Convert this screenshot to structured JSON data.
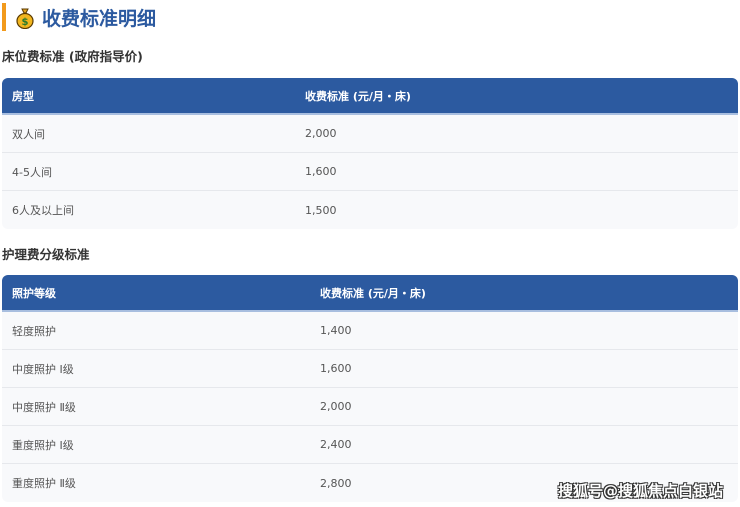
{
  "header": {
    "title": "收费标准明细",
    "icon": "money-bag-icon"
  },
  "bed_fees": {
    "title": "床位费标准 (政府指导价)",
    "columns": [
      "房型",
      "收费标准 (元/月・床)"
    ],
    "rows": [
      [
        "双人间",
        "2,000"
      ],
      [
        "4-5人间",
        "1,600"
      ],
      [
        "6人及以上间",
        "1,500"
      ]
    ]
  },
  "care_fees": {
    "title": "护理费分级标准",
    "columns": [
      "照护等级",
      "收费标准 (元/月・床)"
    ],
    "rows": [
      [
        "轻度照护",
        "1,400"
      ],
      [
        "中度照护 Ⅰ级",
        "1,600"
      ],
      [
        "中度照护 Ⅱ级",
        "2,000"
      ],
      [
        "重度照护 Ⅰ级",
        "2,400"
      ],
      [
        "重度照护 Ⅱ级",
        "2,800"
      ]
    ]
  },
  "watermark": "搜狐号@搜狐焦点白银站",
  "colors": {
    "accent": "#2c5aa0",
    "title_bar": "#f29a1c"
  }
}
